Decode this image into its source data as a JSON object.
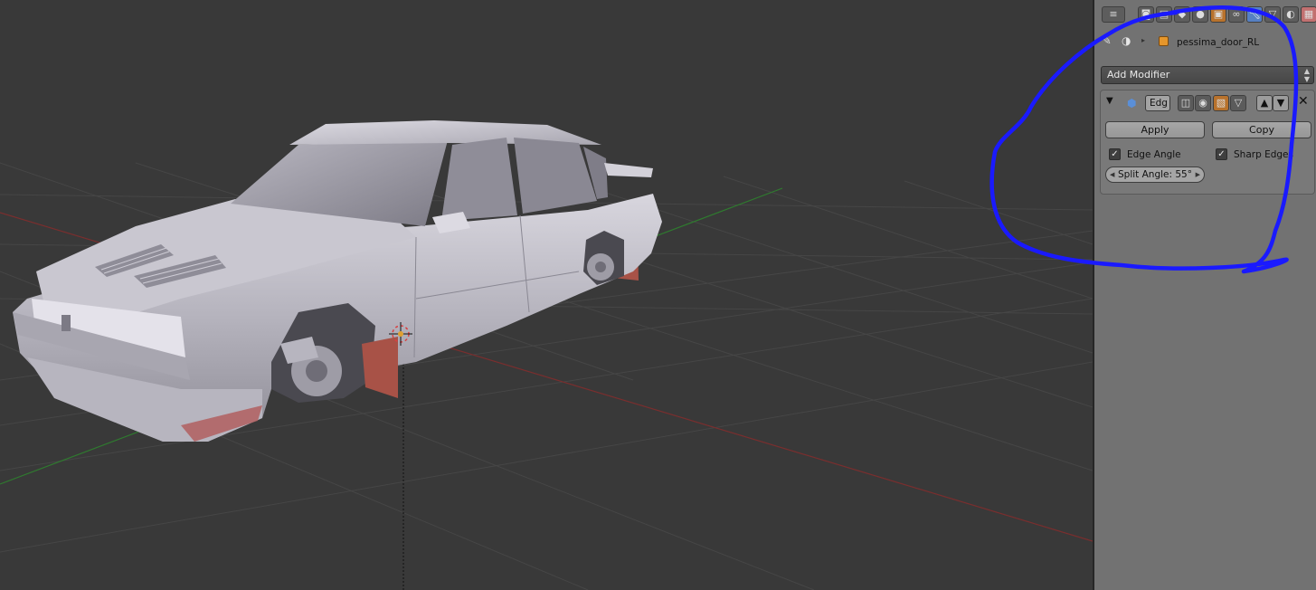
{
  "properties_panel": {
    "object_name": "pessima_door_RL",
    "add_modifier_label": "Add Modifier",
    "modifier": {
      "name_field": "Edg",
      "apply_label": "Apply",
      "copy_label": "Copy",
      "edge_angle_label": "Edge Angle",
      "edge_angle_checked": true,
      "sharp_edges_label": "Sharp Edges",
      "sharp_edges_checked": true,
      "split_angle_label": "Split Angle: 55°"
    }
  },
  "colors": {
    "viewport_bg": "#393939",
    "panel_bg": "#727272",
    "active_tab": "#5680c2",
    "annotation_stroke": "#1a1aff"
  }
}
